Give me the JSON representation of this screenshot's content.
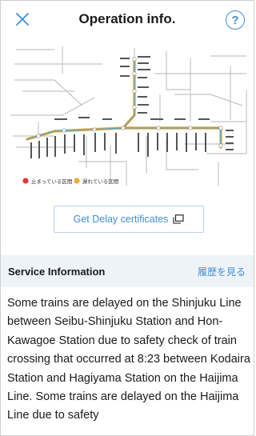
{
  "header": {
    "title": "Operation info.",
    "help_label": "?"
  },
  "map": {
    "legend": [
      {
        "color": "#e53935",
        "label": "止まっている区間"
      },
      {
        "color": "#f2a93b",
        "label": "遅れている区間"
      }
    ]
  },
  "actions": {
    "delay_cert_label": "Get Delay certificates"
  },
  "service": {
    "title": "Service Information",
    "history_label": "履歴を見る",
    "body": "Some trains are delayed on the Shinjuku Line between Seibu-Shinjuku Station and Hon-Kawagoe Station due to safety check of train crossing that occurred at 8:23 between Kodaira Station and Hagiyama Station on the Haijima Line. Some trains are delayed on the Haijima Line due to safety"
  },
  "colors": {
    "accent": "#3f8fd8",
    "stopped": "#e53935",
    "delayed": "#f2a93b",
    "section_bg": "#eef3f8"
  }
}
